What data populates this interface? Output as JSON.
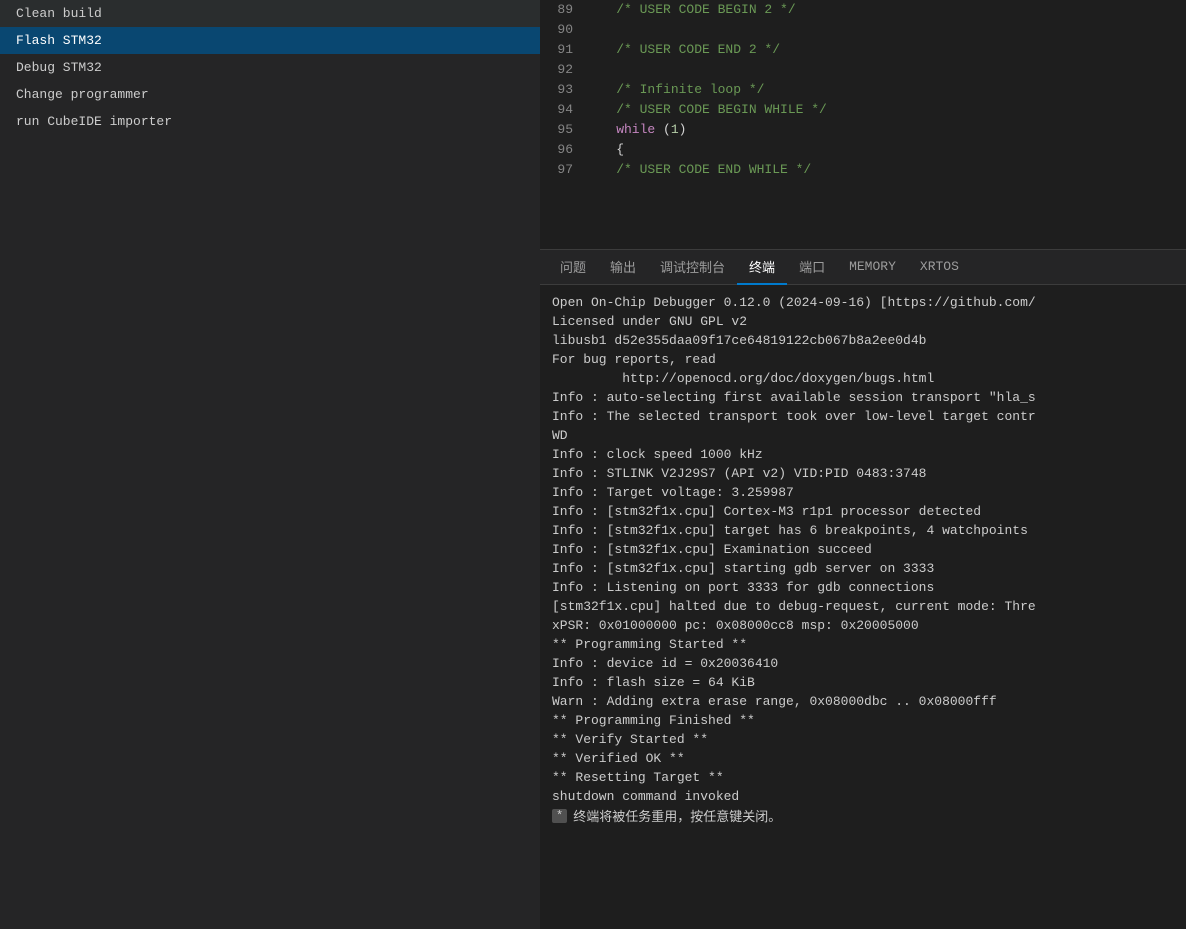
{
  "sidebar": {
    "items": [
      {
        "id": "clean-build",
        "label": "Clean build",
        "active": false
      },
      {
        "id": "flash-stm32",
        "label": "Flash STM32",
        "active": true
      },
      {
        "id": "debug-stm32",
        "label": "Debug STM32",
        "active": false
      },
      {
        "id": "change-programmer",
        "label": "Change programmer",
        "active": false
      },
      {
        "id": "run-cubeide-importer",
        "label": "run CubeIDE importer",
        "active": false
      }
    ]
  },
  "code": {
    "lines": [
      {
        "num": "89",
        "content": "    /* USER CODE BEGIN 2 */",
        "type": "comment"
      },
      {
        "num": "90",
        "content": ""
      },
      {
        "num": "91",
        "content": "    /* USER CODE END 2 */",
        "type": "comment"
      },
      {
        "num": "92",
        "content": ""
      },
      {
        "num": "93",
        "content": "    /* Infinite loop */",
        "type": "comment"
      },
      {
        "num": "94",
        "content": "    /* USER CODE BEGIN WHILE */",
        "type": "comment"
      },
      {
        "num": "95",
        "content": "    while (1)",
        "type": "keyword"
      },
      {
        "num": "96",
        "content": "    {",
        "type": "normal"
      },
      {
        "num": "97",
        "content": "    /* USER CODE END WHILE */",
        "type": "comment"
      }
    ]
  },
  "terminal": {
    "tabs": [
      {
        "id": "problems",
        "label": "问题",
        "active": false
      },
      {
        "id": "output",
        "label": "输出",
        "active": false
      },
      {
        "id": "debug-console",
        "label": "调试控制台",
        "active": false
      },
      {
        "id": "terminal",
        "label": "终端",
        "active": true
      },
      {
        "id": "ports",
        "label": "端口",
        "active": false
      },
      {
        "id": "memory",
        "label": "MEMORY",
        "active": false
      },
      {
        "id": "xrtos",
        "label": "XRTOS",
        "active": false
      }
    ],
    "lines": [
      {
        "text": "Open On-Chip Debugger 0.12.0 (2024-09-16) [https://github.com/",
        "type": "normal"
      },
      {
        "text": "Licensed under GNU GPL v2",
        "type": "normal"
      },
      {
        "text": "libusb1 d52e355daa09f17ce64819122cb067b8a2ee0d4b",
        "type": "normal"
      },
      {
        "text": "For bug reports, read",
        "type": "normal"
      },
      {
        "text": "         http://openocd.org/doc/doxygen/bugs.html",
        "type": "normal"
      },
      {
        "text": "Info : auto-selecting first available session transport \"hla_s",
        "type": "normal"
      },
      {
        "text": "Info : The selected transport took over low-level target contr",
        "type": "normal"
      },
      {
        "text": "WD",
        "type": "normal"
      },
      {
        "text": "Info : clock speed 1000 kHz",
        "type": "normal"
      },
      {
        "text": "Info : STLINK V2J29S7 (API v2) VID:PID 0483:3748",
        "type": "normal"
      },
      {
        "text": "Info : Target voltage: 3.259987",
        "type": "normal"
      },
      {
        "text": "Info : [stm32f1x.cpu] Cortex-M3 r1p1 processor detected",
        "type": "normal"
      },
      {
        "text": "Info : [stm32f1x.cpu] target has 6 breakpoints, 4 watchpoints",
        "type": "normal"
      },
      {
        "text": "Info : [stm32f1x.cpu] Examination succeed",
        "type": "normal"
      },
      {
        "text": "Info : [stm32f1x.cpu] starting gdb server on 3333",
        "type": "normal"
      },
      {
        "text": "Info : Listening on port 3333 for gdb connections",
        "type": "normal"
      },
      {
        "text": "[stm32f1x.cpu] halted due to debug-request, current mode: Thre",
        "type": "normal"
      },
      {
        "text": "xPSR: 0x01000000 pc: 0x08000cc8 msp: 0x20005000",
        "type": "normal"
      },
      {
        "text": "** Programming Started **",
        "type": "normal"
      },
      {
        "text": "Info : device id = 0x20036410",
        "type": "normal"
      },
      {
        "text": "Info : flash size = 64 KiB",
        "type": "normal"
      },
      {
        "text": "Warn : Adding extra erase range, 0x08000dbc .. 0x08000fff",
        "type": "warn"
      },
      {
        "text": "** Programming Finished **",
        "type": "normal"
      },
      {
        "text": "** Verify Started **",
        "type": "normal"
      },
      {
        "text": "** Verified OK **",
        "type": "normal"
      },
      {
        "text": "** Resetting Target **",
        "type": "normal"
      },
      {
        "text": "shutdown command invoked",
        "type": "normal"
      }
    ],
    "star_line": {
      "badge": "*",
      "message": "终端将被任务重用，按任意键关闭。"
    }
  }
}
